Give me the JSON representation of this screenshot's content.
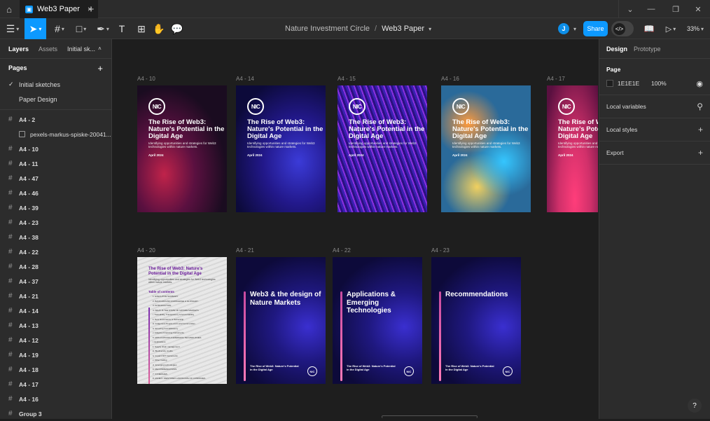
{
  "titlebar": {
    "tab_title": "Web3 Paper"
  },
  "breadcrumb": {
    "team": "Nature Investment Circle",
    "file": "Web3 Paper"
  },
  "user": {
    "initial": "J"
  },
  "share_label": "Share",
  "zoom": "33%",
  "left_panel": {
    "tabs": {
      "layers": "Layers",
      "assets": "Assets",
      "page_select": "Initial sk..."
    },
    "pages_header": "Pages",
    "pages": [
      "Initial sketches",
      "Paper Design"
    ],
    "layers": [
      "A4 - 2",
      "pexels-markus-spiske-20041...",
      "A4 - 10",
      "A4 - 11",
      "A4 - 47",
      "A4 - 46",
      "A4 - 39",
      "A4 - 23",
      "A4 - 38",
      "A4 - 22",
      "A4 - 28",
      "A4 - 37",
      "A4 - 21",
      "A4 - 14",
      "A4 - 13",
      "A4 - 12",
      "A4 - 19",
      "A4 - 18",
      "A4 - 17",
      "A4 - 16",
      "Group 3"
    ]
  },
  "right_panel": {
    "tabs": {
      "design": "Design",
      "prototype": "Prototype"
    },
    "page_label": "Page",
    "fill_hex": "1E1E1E",
    "fill_opacity": "100%",
    "local_variables": "Local variables",
    "local_styles": "Local styles",
    "export": "Export"
  },
  "canvas": {
    "frame_labels": [
      "A4 - 10",
      "A4 - 14",
      "A4 - 15",
      "A4 - 16",
      "A4 - 17",
      "A4 - 20",
      "A4 - 21",
      "A4 - 22",
      "A4 - 23"
    ],
    "cover": {
      "logo": "NIC",
      "title": "The Rise of Web3: Nature's Potential in the Digital Age",
      "subtitle": "Identifying opportunities and strategies for Web3 technologies within nature markets.",
      "date": "April 2024"
    },
    "toc": {
      "title": "The Rise of Web3: Nature's Potential in the Digital Age",
      "subtitle": "Identifying opportunities and strategies for Web3 technologies within nature markets.",
      "heading": "Table of contents",
      "items": [
        "1. EXECUTIVE SUMMARY",
        "2. BACKGROUND KNOWLEDGE & GLOSSARY",
        "3. INTRODUCTION",
        "4. WHAT IS THE STATE OF NATURE MARKETS",
        "   i. Traceability, Transparency & Accountability",
        "   ii. New Governance & Ownership",
        "   iii. Indigenous People and Local Communities",
        "   iv. Ensuring Cost Efficiency",
        "   v. Adaptive Financing Instruments",
        "5. APPLICATIONS & EMERGING TECHNOLOGIES",
        "   i. Applications",
        "   ii. Supply chain management",
        "   iii. Biodiversity credits",
        "   iv. Impact NFT Instruments",
        "   v. Other trading",
        "   vi. Emerging technologies",
        "6. RECOMMENDATIONS",
        "7. SYNERGIES",
        "8. ANNEX I IDENTIFIED LANDSCAPE OF COMPANIES"
      ]
    },
    "sections": [
      "Web3 & the design of Nature Markets",
      "Applications & Emerging Technologies",
      "Recommendations"
    ],
    "footer_text": "The Rise of Web3: Nature's Potential in the Digital Age",
    "footer_logo": "NIC"
  },
  "colors": {
    "accent": "#0d99ff",
    "bg": "#1e1e1e",
    "panel": "#2c2c2c"
  }
}
